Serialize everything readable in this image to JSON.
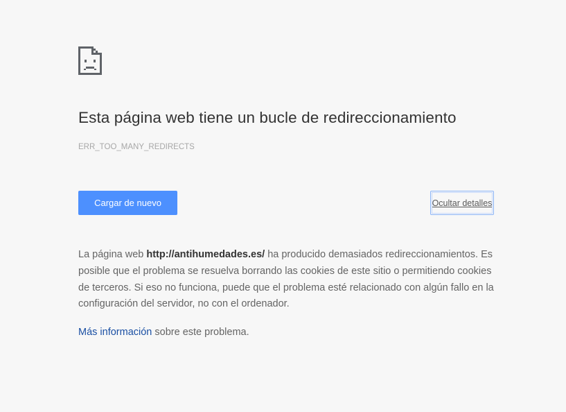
{
  "error": {
    "icon": "sad-page-icon",
    "title": "Esta página web tiene un bucle de redireccionamiento",
    "code": "ERR_TOO_MANY_REDIRECTS"
  },
  "buttons": {
    "reload_label": "Cargar de nuevo",
    "details_label": "Ocultar detalles"
  },
  "details": {
    "prefix": "La página web ",
    "url": "http://antihumedades.es/",
    "suffix": " ha producido demasiados redireccionamientos. Es posible que el problema se resuelva borrando las cookies de este sitio o permitiendo cookies de terceros. Si eso no funciona, puede que el problema esté relacionado con algún fallo en la configuración del servidor, no con el ordenador."
  },
  "more_info": {
    "link_text": "Más información",
    "suffix": " sobre este problema."
  },
  "colors": {
    "background": "#f7f7f7",
    "primary_button": "#4d90fe",
    "link": "#1a4fa3"
  }
}
